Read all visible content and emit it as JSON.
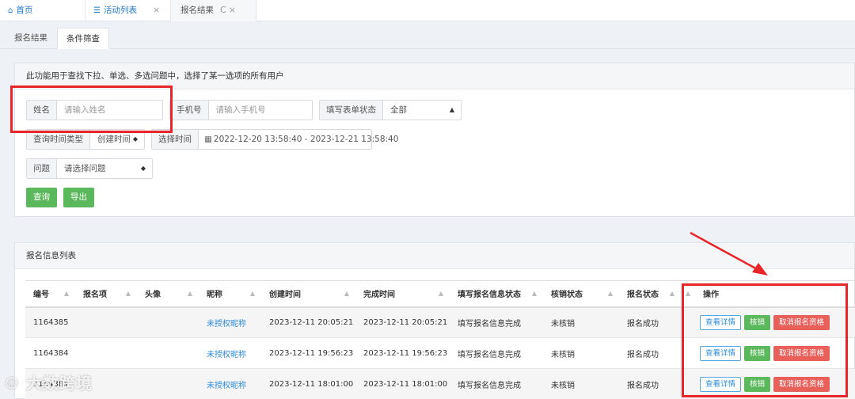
{
  "top_tabs": [
    {
      "label": "首页",
      "icon": "home-icon"
    },
    {
      "label": "活动列表",
      "icon": "list-icon",
      "close": "×"
    },
    {
      "label": "报名结果",
      "close": "×",
      "refresh": "C"
    }
  ],
  "sub_tabs": [
    "报名结果",
    "条件筛查"
  ],
  "filter": {
    "description": "此功能用于查找下拉、单选、多选问题中，选择了某一选项的所有用户",
    "name_label": "姓名",
    "name_placeholder": "请输入姓名",
    "phone_label": "手机号",
    "phone_placeholder": "请输入手机号",
    "form_status_label": "填写表单状态",
    "form_status_value": "全部",
    "time_type_label": "查询时间类型",
    "time_type_value": "创建时间",
    "time_range_label": "选择时间",
    "time_range_value": "2022-12-20 13:58:40 - 2023-12-21 13:58:40",
    "question_label": "问题",
    "question_value": "请选择问题",
    "query_button": "查询",
    "export_button": "导出"
  },
  "list": {
    "title": "报名信息列表",
    "columns": [
      "编号",
      "报名项",
      "头像",
      "昵称",
      "创建时间",
      "完成时间",
      "填写报名信息状态",
      "核销状态",
      "报名状态",
      "操作"
    ],
    "rows": [
      {
        "id": "1164385",
        "item": "",
        "avatar": "",
        "nickname": "未授权昵称",
        "created": "2023-12-11 20:05:21",
        "completed": "2023-12-11 20:05:21",
        "fill_status": "填写报名信息完成",
        "verify_status": "未核销",
        "signup_status": "报名成功"
      },
      {
        "id": "1164384",
        "item": "",
        "avatar": "",
        "nickname": "未授权昵称",
        "created": "2023-12-11 19:56:23",
        "completed": "2023-12-11 19:56:23",
        "fill_status": "填写报名信息完成",
        "verify_status": "未核销",
        "signup_status": "报名成功"
      },
      {
        "id": "1164384",
        "item": "",
        "avatar": "",
        "nickname": "未授权昵称",
        "created": "2023-12-11 18:01:00",
        "completed": "2023-12-11 18:01:00",
        "fill_status": "填写报名信息完成",
        "verify_status": "未核销",
        "signup_status": "报名成功"
      }
    ],
    "actions": {
      "detail": "查看详情",
      "verify": "核销",
      "cancel": "取消报名资格"
    }
  },
  "watermark": "大数跨境",
  "colors": {
    "accent": "#1e78c8",
    "green": "#5cb85c",
    "red": "#e9605b",
    "annotation_red": "#e8262a"
  }
}
